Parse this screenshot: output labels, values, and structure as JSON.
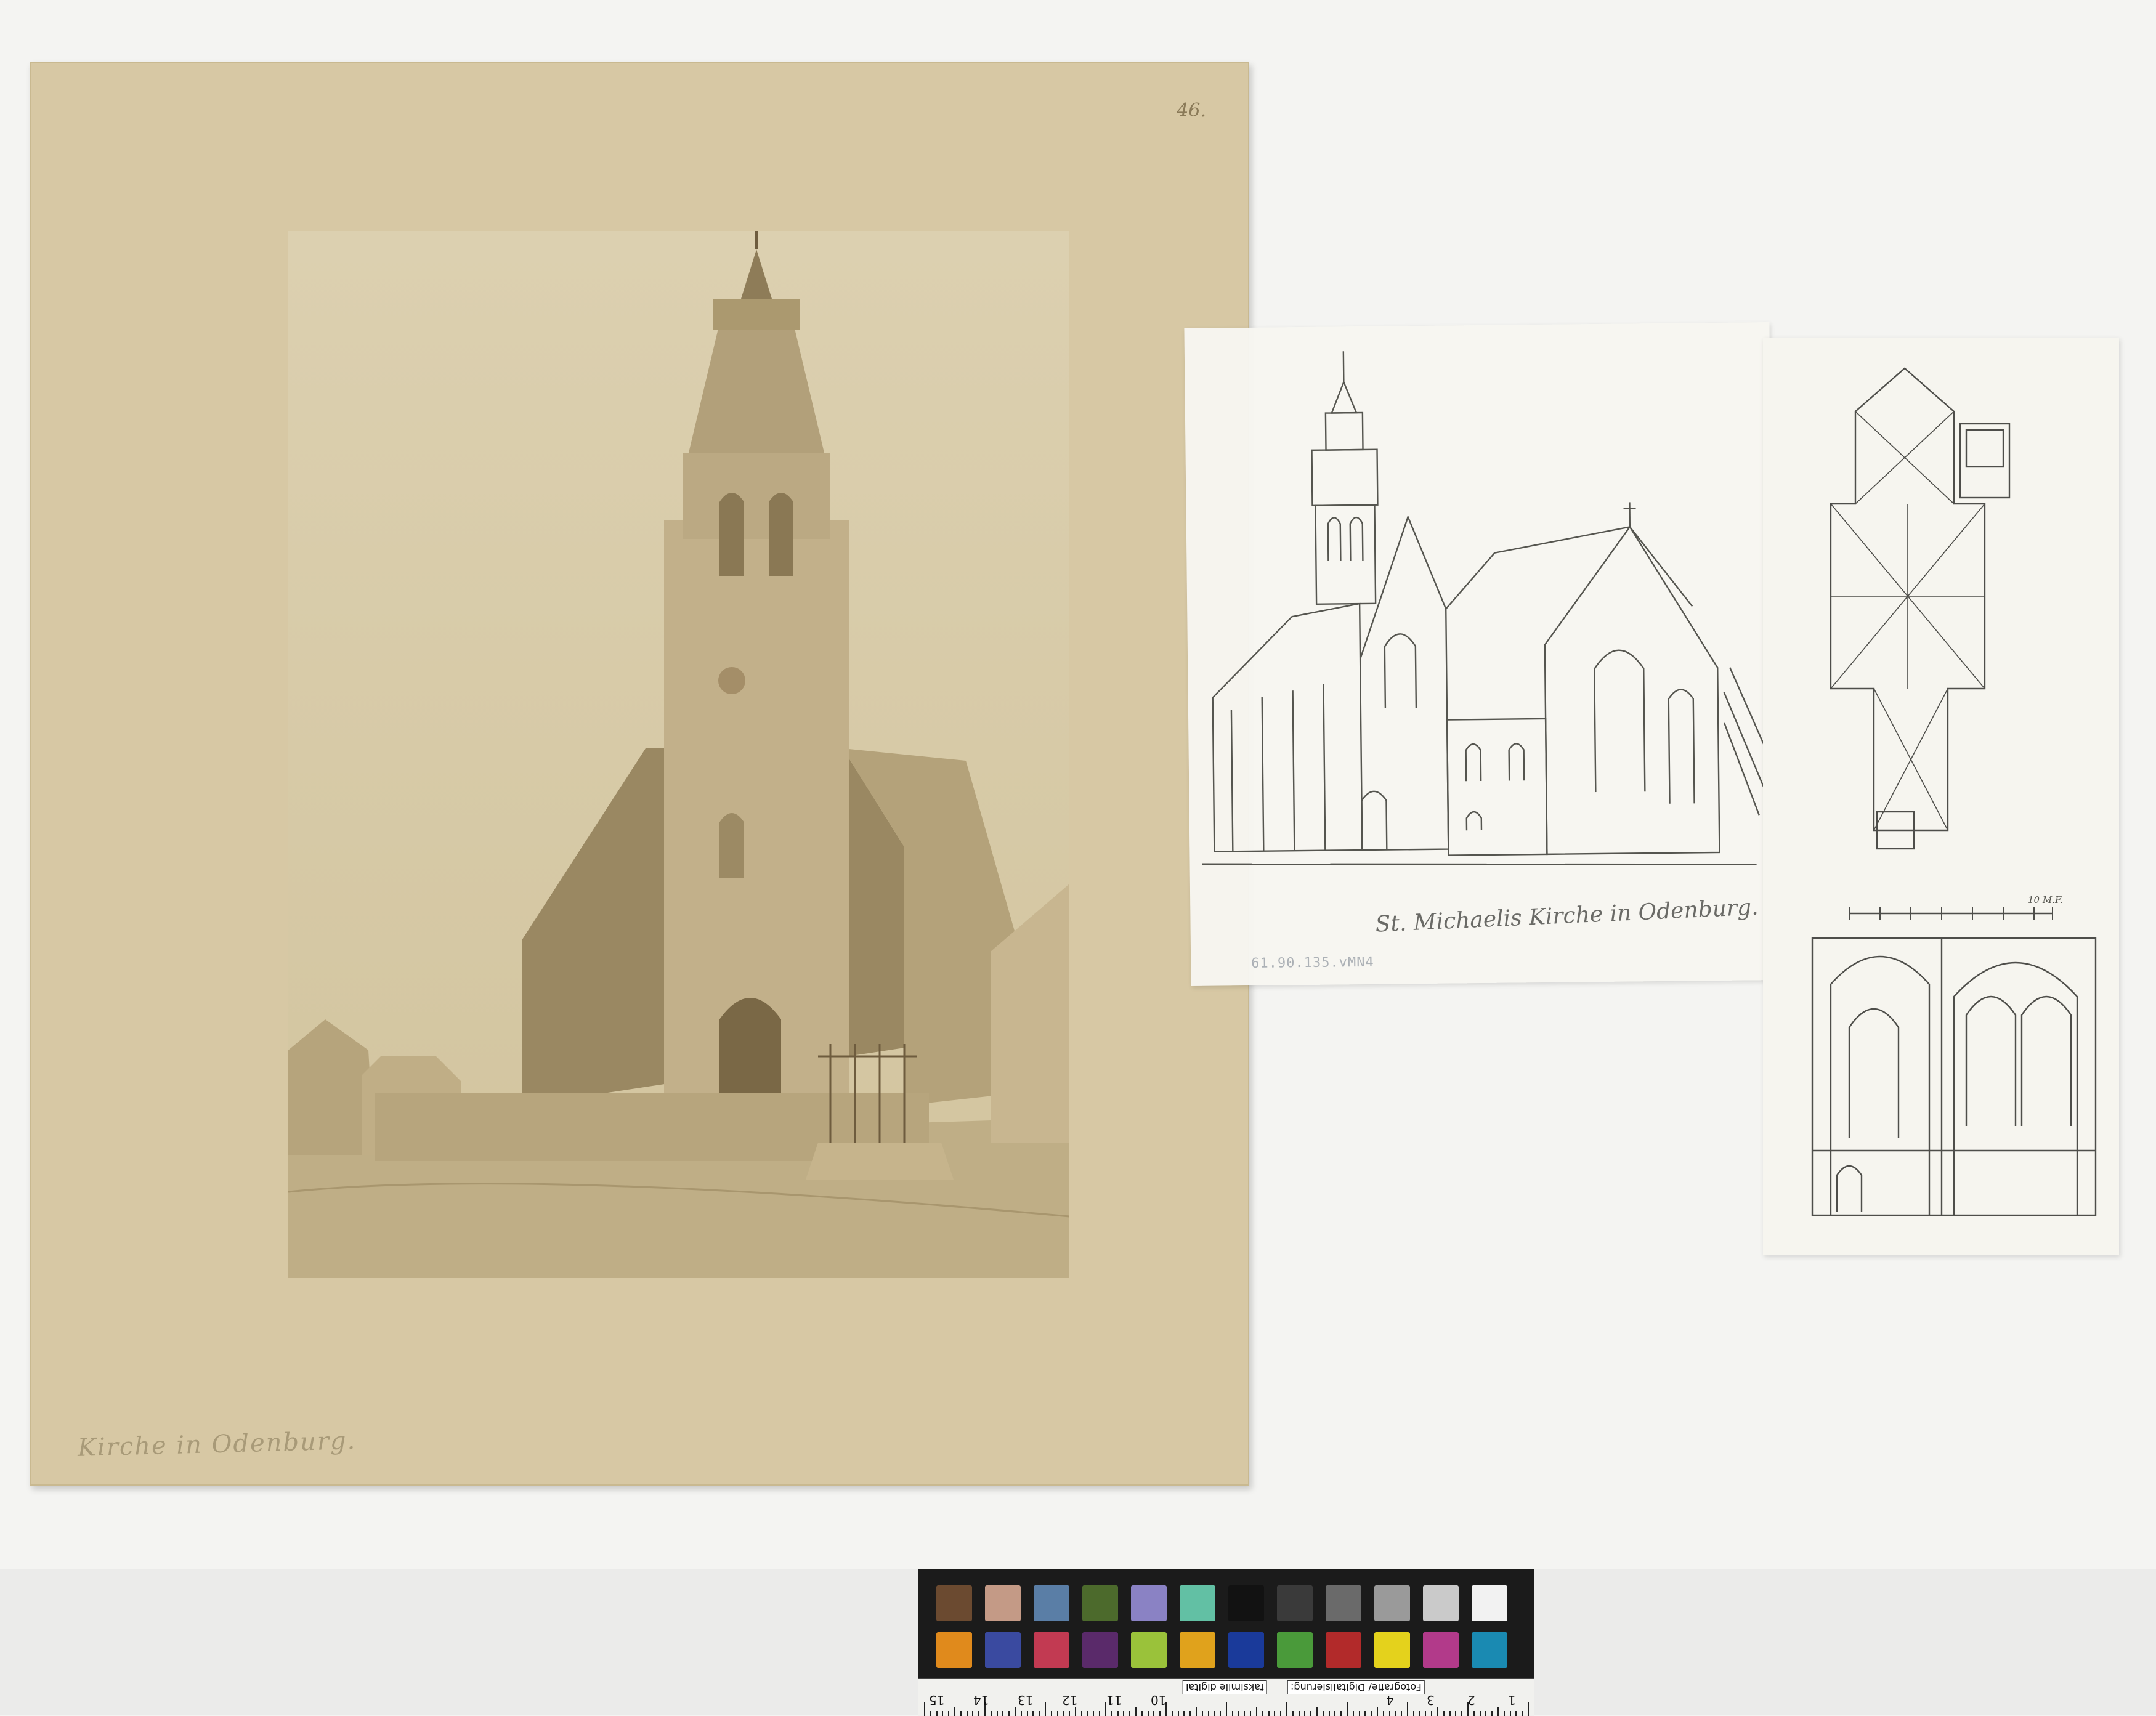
{
  "board": {
    "page_number": "46.",
    "caption": "Kirche in Odenburg."
  },
  "sketch": {
    "caption": "St. Michaelis Kirche in Odenburg.",
    "archive_stamp": "61.90.135.vMN4"
  },
  "plan": {
    "scale_label": "10 M.F."
  },
  "color_checker": {
    "top_row": [
      "#6b4a30",
      "#c49a86",
      "#5a7ea6",
      "#4c6a2c",
      "#8a82c4",
      "#62c0a4",
      "#121212",
      "#3a3a3a",
      "#6a6a6a",
      "#9a9a9a",
      "#cacaca",
      "#f2f2f2"
    ],
    "bottom_row": [
      "#e08a1c",
      "#3a4aa0",
      "#c23a52",
      "#5a2a6a",
      "#9ac23a",
      "#e0a21c",
      "#1a3a9a",
      "#4a9a3a",
      "#b22a2a",
      "#e4d21c",
      "#b23a8a",
      "#1a8ab2"
    ],
    "ruler_numbers": [
      "15",
      "14",
      "13",
      "12",
      "11",
      "10",
      "4",
      "3",
      "2",
      "1"
    ],
    "ruler_labels": [
      "faksimile digital",
      "Fotografie/ Digitalisierung:"
    ]
  }
}
